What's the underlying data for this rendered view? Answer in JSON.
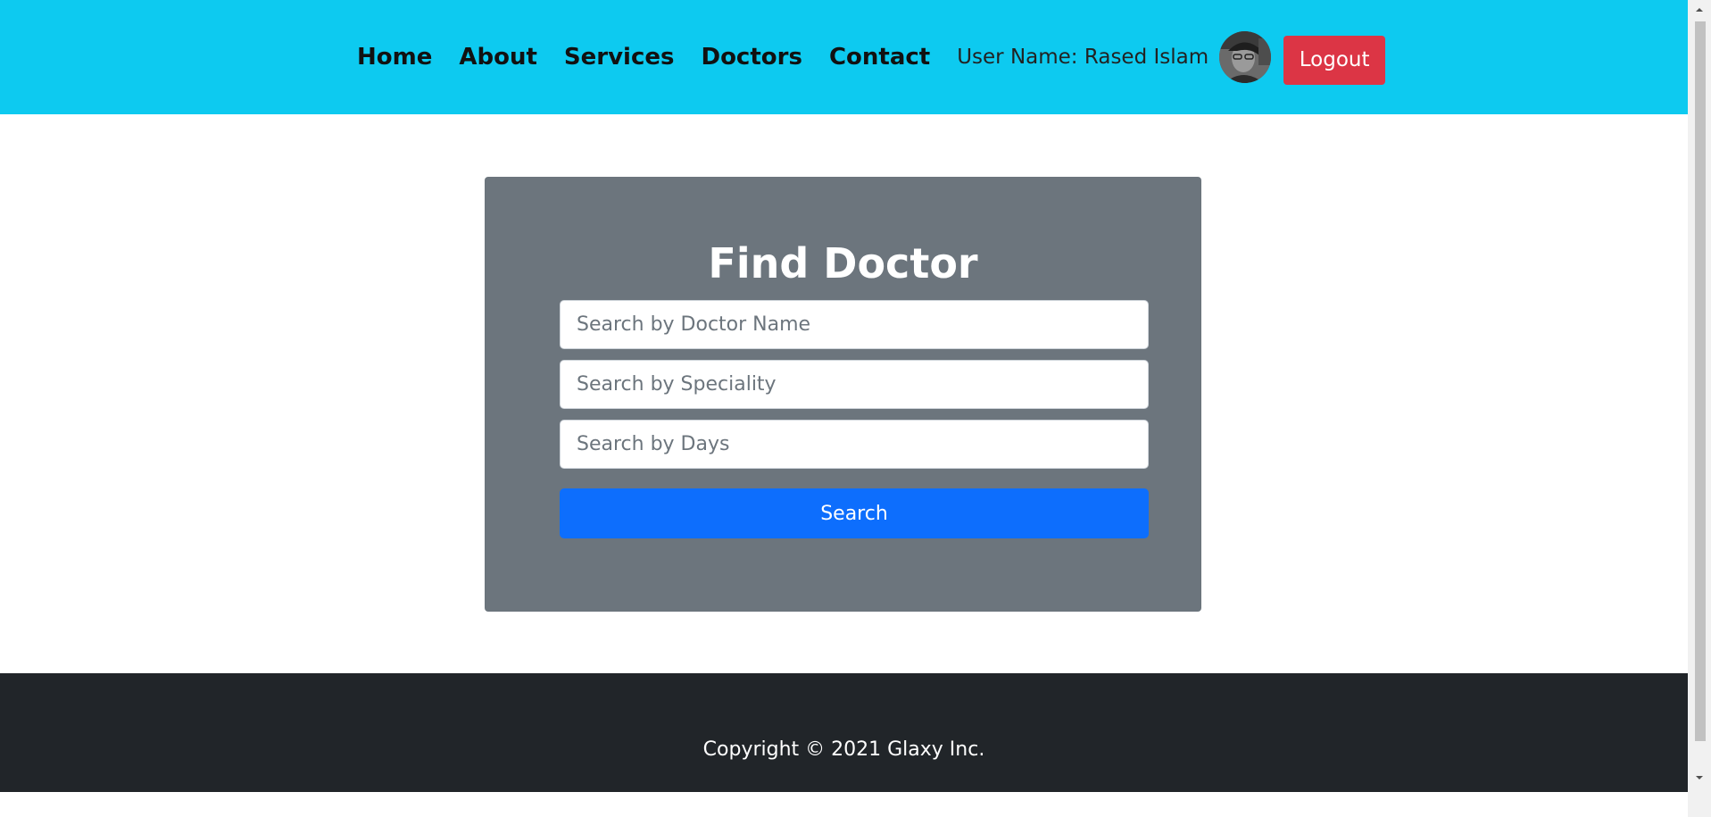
{
  "nav": {
    "links": [
      "Home",
      "About",
      "Services",
      "Doctors",
      "Contact"
    ],
    "user_label": "User Name: Rased Islam",
    "logout_label": "Logout"
  },
  "search_card": {
    "title": "Find Doctor",
    "doctor_name_placeholder": "Search by Doctor Name",
    "speciality_placeholder": "Search by Speciality",
    "days_placeholder": "Search by Days",
    "search_label": "Search"
  },
  "footer": {
    "copyright": "Copyright © 2021 Glaxy Inc."
  },
  "colors": {
    "navbar": "#0dcaf0",
    "logout": "#dc3545",
    "card": "#6c757d",
    "search_button": "#0d6efd",
    "footer": "#212529"
  }
}
